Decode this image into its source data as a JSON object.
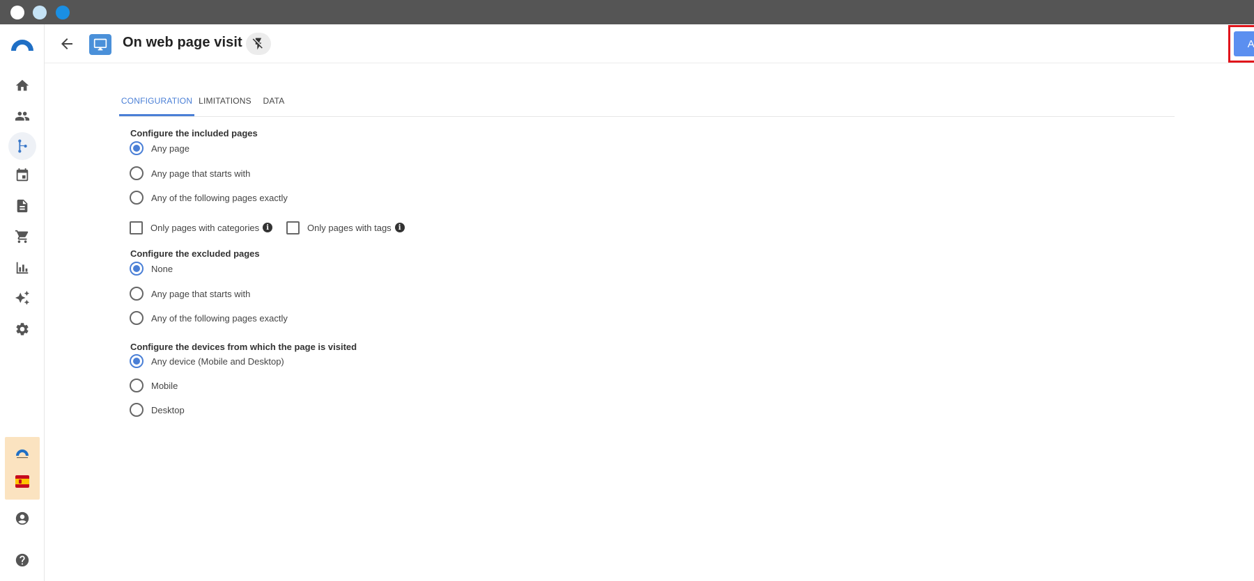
{
  "window": {
    "controls": [
      "close",
      "minimize",
      "maximize"
    ]
  },
  "sidebar": {
    "items": [
      {
        "name": "home",
        "icon": "home-icon"
      },
      {
        "name": "contacts",
        "icon": "people-icon"
      },
      {
        "name": "automations",
        "icon": "flow-icon",
        "active": true
      },
      {
        "name": "calendar",
        "icon": "calendar-icon"
      },
      {
        "name": "content",
        "icon": "document-icon"
      },
      {
        "name": "ecommerce",
        "icon": "cart-icon"
      },
      {
        "name": "analytics",
        "icon": "bar-chart-icon"
      },
      {
        "name": "ai",
        "icon": "sparkle-icon"
      },
      {
        "name": "settings",
        "icon": "gear-icon"
      },
      {
        "name": "account",
        "icon": "account-icon"
      },
      {
        "name": "help",
        "icon": "help-icon"
      }
    ],
    "language_flag": "es"
  },
  "header": {
    "title": "On web page visit",
    "apply_label": "Apply"
  },
  "tabs": [
    {
      "label": "CONFIGURATION",
      "active": true
    },
    {
      "label": "LIMITATIONS",
      "active": false
    },
    {
      "label": "DATA",
      "active": false
    }
  ],
  "included": {
    "title": "Configure the included pages",
    "options": [
      "Any page",
      "Any page that starts with",
      "Any of the following pages exactly"
    ],
    "selected": 0,
    "only_categories": "Only pages with categories",
    "only_tags": "Only pages with tags",
    "info_glyph": "i"
  },
  "excluded": {
    "title": "Configure the excluded pages",
    "options": [
      "None",
      "Any page that starts with",
      "Any of the following pages exactly"
    ],
    "selected": 0
  },
  "devices": {
    "title": "Configure the devices from which the page is visited",
    "options": [
      "Any device (Mobile and Desktop)",
      "Mobile",
      "Desktop"
    ],
    "selected": 0
  },
  "colors": {
    "accent": "#4a7fd6",
    "apply_button": "#5b8ff0",
    "highlight": "#e0141b",
    "titlebar": "#555555"
  }
}
